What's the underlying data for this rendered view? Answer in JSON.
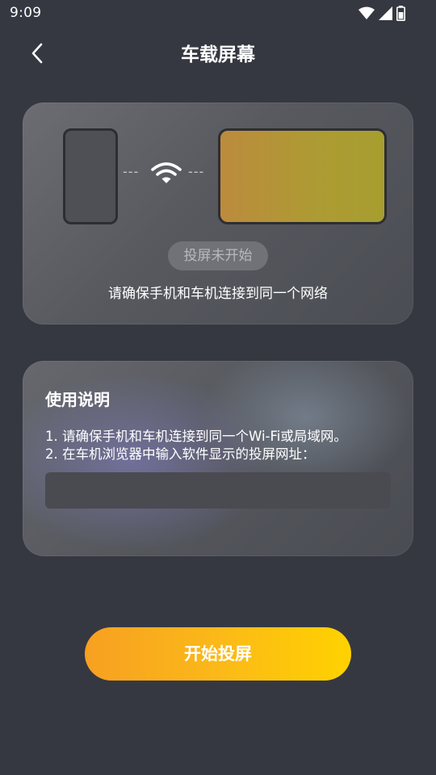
{
  "status_bar": {
    "time": "9:09"
  },
  "header": {
    "title": "车载屏幕",
    "back_icon": "chevron-left-icon"
  },
  "connection_card": {
    "dash_left": "---",
    "dash_right": "---",
    "wifi_icon": "wifi-icon",
    "status_label": "投屏未开始",
    "network_hint": "请确保手机和车机连接到同一个网络"
  },
  "instructions": {
    "title": "使用说明",
    "step_1": "1. 请确保手机和车机连接到同一个Wi-Fi或局域网。",
    "step_2": "2. 在车机浏览器中输入软件显示的投屏网址：",
    "url_value": ""
  },
  "actions": {
    "start_label": "开始投屏"
  },
  "colors": {
    "background": "#363841",
    "button_start": "#f7a021",
    "button_end": "#ffd200",
    "car_screen": "#b0923a"
  }
}
